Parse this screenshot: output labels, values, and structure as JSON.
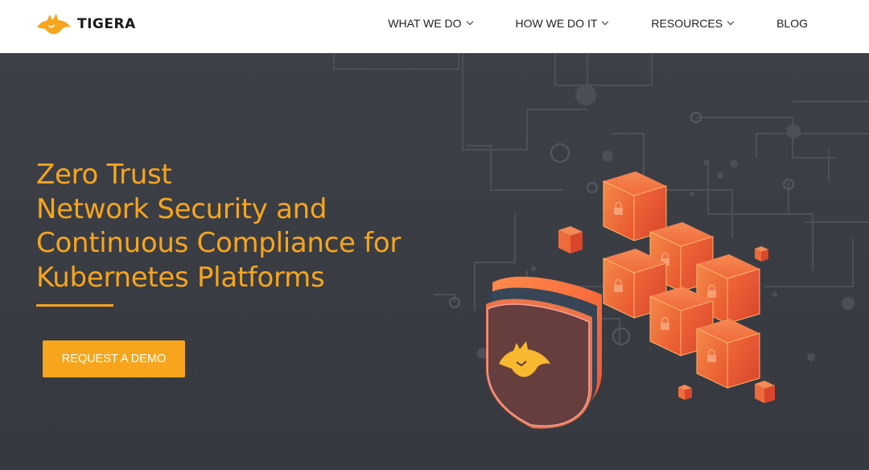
{
  "brand": {
    "name": "TIGERA"
  },
  "nav": {
    "items": [
      {
        "label": "WHAT WE DO",
        "has_dropdown": true
      },
      {
        "label": "HOW WE DO IT",
        "has_dropdown": true
      },
      {
        "label": "RESOURCES",
        "has_dropdown": true
      },
      {
        "label": "BLOG",
        "has_dropdown": false
      }
    ]
  },
  "hero": {
    "headline_lines": [
      "Zero Trust",
      "Network Security and",
      "Continuous Compliance for",
      "Kubernetes Platforms"
    ],
    "cta_label": "REQUEST A DEMO"
  },
  "colors": {
    "accent": "#f7a51c",
    "hero_bg": "#3a3d43",
    "nav_bg": "#ffffff",
    "cube": "#ee5a33"
  },
  "icons": [
    "tiger-logo-icon",
    "chevron-down-icon",
    "shield-icon",
    "lock-icon",
    "tiger-emblem-icon"
  ]
}
